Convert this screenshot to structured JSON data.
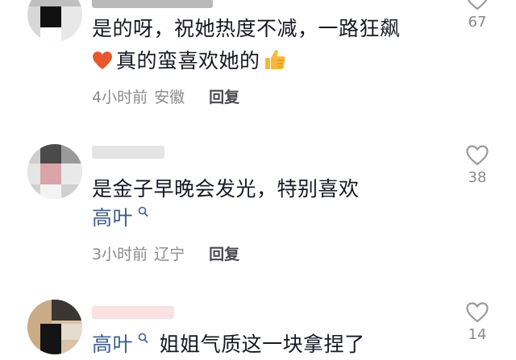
{
  "comments": [
    {
      "text_line1": "是的呀，祝她热度不减，一路狂飙",
      "text_line2": "真的蛮喜欢她的",
      "time": "4小时前",
      "location": "安徽",
      "reply_label": "回复",
      "likes": "67",
      "emojis": [
        "red-heart-emoji",
        "thumbs-up-emoji"
      ]
    },
    {
      "text": "是金子早晚会发光，特别喜欢",
      "mention": "高叶",
      "time": "3小时前",
      "location": "辽宁",
      "reply_label": "回复",
      "likes": "38"
    },
    {
      "mention": "高叶",
      "text": "姐姐气质这一块拿捏了",
      "likes": "14"
    }
  ],
  "icons": {
    "like": "heart-outline-icon",
    "mention": "search-icon"
  },
  "colors": {
    "text": "#161823",
    "secondary": "#8a8a8f",
    "mention": "#3f5f8f",
    "heart_emoji": "#e8582e",
    "thumb_emoji": "#f5b83a"
  }
}
